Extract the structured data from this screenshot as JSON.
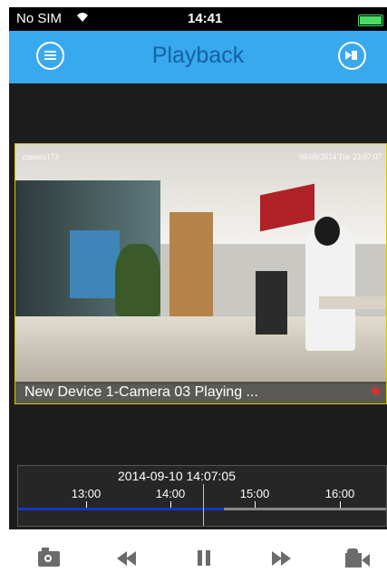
{
  "status_bar": {
    "carrier": "No SIM",
    "wifi_icon": "wifi-icon",
    "time": "14:41",
    "battery_icon": "battery-icon"
  },
  "nav": {
    "title": "Playback",
    "left_icon": "menu-icon",
    "right_icon": "playback-mode-icon",
    "bar_color": "#38a9ef",
    "title_color": "#1462a4"
  },
  "video": {
    "camera_osd": "camera173",
    "timestamp_osd": "09/09/2014 Tue 23:07:07",
    "caption": "New Device 1-Camera 03  Playing ...",
    "audio_icon": "speaker-icon",
    "border_color": "#d8c400"
  },
  "timeline": {
    "current_time": "2014-09-10 14:07:05",
    "ticks": [
      "13:00",
      "14:00",
      "15:00",
      "16:00"
    ],
    "progress_fraction": 0.56,
    "progress_color": "#1535c8",
    "cursor_color": "#e8d600"
  },
  "controls": [
    "camera-icon",
    "rewind-icon",
    "pause-icon",
    "fast-forward-icon",
    "video-record-icon"
  ]
}
